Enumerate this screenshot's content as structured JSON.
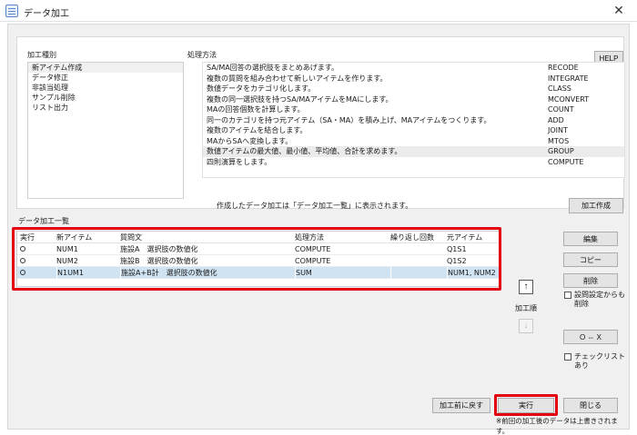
{
  "window": {
    "title": "データ加工",
    "close_glyph": "✕"
  },
  "top": {
    "type_label": "加工種別",
    "method_label": "処理方法",
    "help_label": "HELP",
    "types": [
      "新アイテム作成",
      "データ修正",
      "非該当処理",
      "サンプル削除",
      "リスト出力"
    ],
    "methods": [
      {
        "desc": "SA/MA回答の選択肢をまとめあげます。",
        "code": "RECODE"
      },
      {
        "desc": "複数の質問を組み合わせて新しいアイテムを作ります。",
        "code": "INTEGRATE"
      },
      {
        "desc": "数値データをカテゴリ化します。",
        "code": "CLASS"
      },
      {
        "desc": "複数の同一選択肢を持つSA/MAアイテムをMAにします。",
        "code": "MCONVERT"
      },
      {
        "desc": "MAの回答個数を計算します。",
        "code": "COUNT"
      },
      {
        "desc": "同一のカテゴリを持つ元アイテム（SA・MA）を積み上げ、MAアイテムをつくります。",
        "code": "ADD"
      },
      {
        "desc": "複数のアイテムを結合します。",
        "code": "JOINT"
      },
      {
        "desc": "MAからSAへ変換します。",
        "code": "MTOS"
      },
      {
        "desc": "数値アイテムの最大値、最小値、平均値、合計を求めます。",
        "code": "GROUP"
      },
      {
        "desc": "四則演算をします。",
        "code": "COMPUTE"
      }
    ],
    "created_note": "作成したデータ加工は「データ加工一覧」に表示されます。",
    "create_button": "加工作成"
  },
  "list": {
    "label": "データ加工一覧",
    "headers": [
      "実行",
      "新アイテム",
      "質問文",
      "処理方法",
      "繰り返し回数",
      "元アイテム"
    ],
    "rows": [
      {
        "new_item": "NUM1",
        "question": "施設A　選択肢の数値化",
        "method": "COMPUTE",
        "repeat": "",
        "source": "Q1S1",
        "selected": false
      },
      {
        "new_item": "NUM2",
        "question": "施設B　選択肢の数値化",
        "method": "COMPUTE",
        "repeat": "",
        "source": "Q1S2",
        "selected": false
      },
      {
        "new_item": "N1UM1",
        "question": "施設A+B計　選択肢の数値化",
        "method": "SUM",
        "repeat": "",
        "source": "NUM1, NUM2",
        "selected": true
      }
    ]
  },
  "side": {
    "edit": "編集",
    "copy": "コピー",
    "delete": "削除",
    "delete_setting_label_1": "設問設定からも",
    "delete_setting_label_2": "削除",
    "ox": "O ⇔ X",
    "checklist_label": "チェックリストあり",
    "order_label": "加工順",
    "up_glyph": "↑",
    "down_glyph": "↓"
  },
  "bottom": {
    "revert": "加工前に戻す",
    "run": "実行",
    "close": "閉じる",
    "note": "※前回の加工後のデータは上書きされます。"
  },
  "colors": {
    "highlight": "#e3000f",
    "selected_row": "#cfe3f3"
  }
}
